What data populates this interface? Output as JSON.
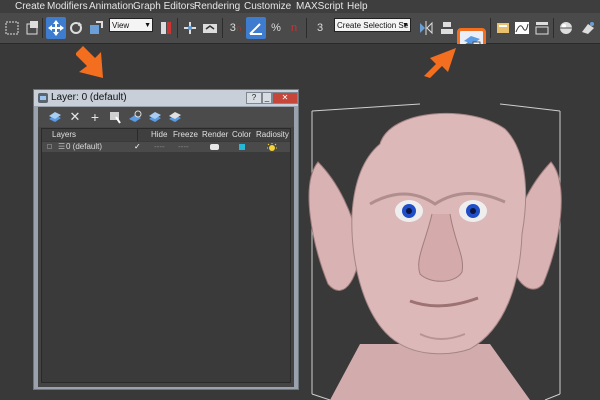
{
  "menu": [
    "Create",
    "Modifiers",
    "Animation",
    "Graph Editors",
    "Rendering",
    "Customize",
    "MAXScript",
    "Help"
  ],
  "toolbar": {
    "view_label": "View",
    "selection_set_placeholder": "Create Selection Se",
    "icon_3": "3",
    "icon_percent": "%",
    "icon_n": "n",
    "icon_3b": "3"
  },
  "dialog": {
    "title": "Layer: 0 (default)",
    "help_label": "?",
    "columns": [
      "Layers",
      "Hide",
      "Freeze",
      "Render",
      "Color",
      "Radiosity"
    ],
    "rows": [
      {
        "name": "0 (default)",
        "check": "✓",
        "hide": "----",
        "freeze": "----"
      }
    ]
  },
  "colors": {
    "highlight": "#f36f1f",
    "active_tool": "#3d7ccf",
    "layer_color_swatch": "#25b8d8",
    "skin": "#d9b3b3"
  }
}
